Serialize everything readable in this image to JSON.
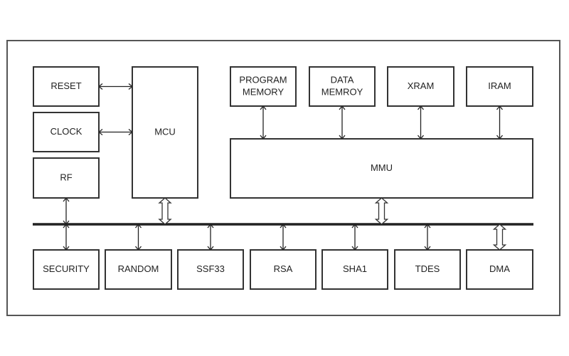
{
  "diagram": {
    "blocks": {
      "reset": {
        "lines": [
          "RESET"
        ]
      },
      "clock": {
        "lines": [
          "CLOCK"
        ]
      },
      "rf": {
        "lines": [
          "RF"
        ]
      },
      "mcu": {
        "lines": [
          "MCU"
        ]
      },
      "program_memory": {
        "lines": [
          "PROGRAM",
          "MEMORY"
        ]
      },
      "data_memory": {
        "lines": [
          "DATA",
          "MEMROY"
        ]
      },
      "xram": {
        "lines": [
          "XRAM"
        ]
      },
      "iram": {
        "lines": [
          "IRAM"
        ]
      },
      "mmu": {
        "lines": [
          "MMU"
        ]
      },
      "security": {
        "lines": [
          "SECURITY"
        ]
      },
      "random": {
        "lines": [
          "RANDOM"
        ]
      },
      "ssf33": {
        "lines": [
          "SSF33"
        ]
      },
      "rsa": {
        "lines": [
          "RSA"
        ]
      },
      "sha1": {
        "lines": [
          "SHA1"
        ]
      },
      "tdes": {
        "lines": [
          "TDES"
        ]
      },
      "dma": {
        "lines": [
          "DMA"
        ]
      }
    },
    "connections": [
      {
        "from": "reset",
        "to": "mcu",
        "type": "bidirectional"
      },
      {
        "from": "clock",
        "to": "mcu",
        "type": "bidirectional"
      },
      {
        "from": "rf",
        "to": "bus",
        "type": "bidirectional"
      },
      {
        "from": "mcu",
        "to": "bus",
        "type": "wide-bidirectional"
      },
      {
        "from": "program_memory",
        "to": "mmu",
        "type": "bidirectional"
      },
      {
        "from": "data_memory",
        "to": "mmu",
        "type": "bidirectional"
      },
      {
        "from": "xram",
        "to": "mmu",
        "type": "bidirectional"
      },
      {
        "from": "iram",
        "to": "mmu",
        "type": "bidirectional"
      },
      {
        "from": "mmu",
        "to": "bus",
        "type": "wide-bidirectional"
      },
      {
        "from": "bus",
        "to": "security",
        "type": "bidirectional"
      },
      {
        "from": "bus",
        "to": "random",
        "type": "bidirectional"
      },
      {
        "from": "bus",
        "to": "ssf33",
        "type": "bidirectional"
      },
      {
        "from": "bus",
        "to": "rsa",
        "type": "bidirectional"
      },
      {
        "from": "bus",
        "to": "sha1",
        "type": "bidirectional"
      },
      {
        "from": "bus",
        "to": "tdes",
        "type": "bidirectional"
      },
      {
        "from": "bus",
        "to": "dma",
        "type": "wide-bidirectional"
      }
    ]
  }
}
